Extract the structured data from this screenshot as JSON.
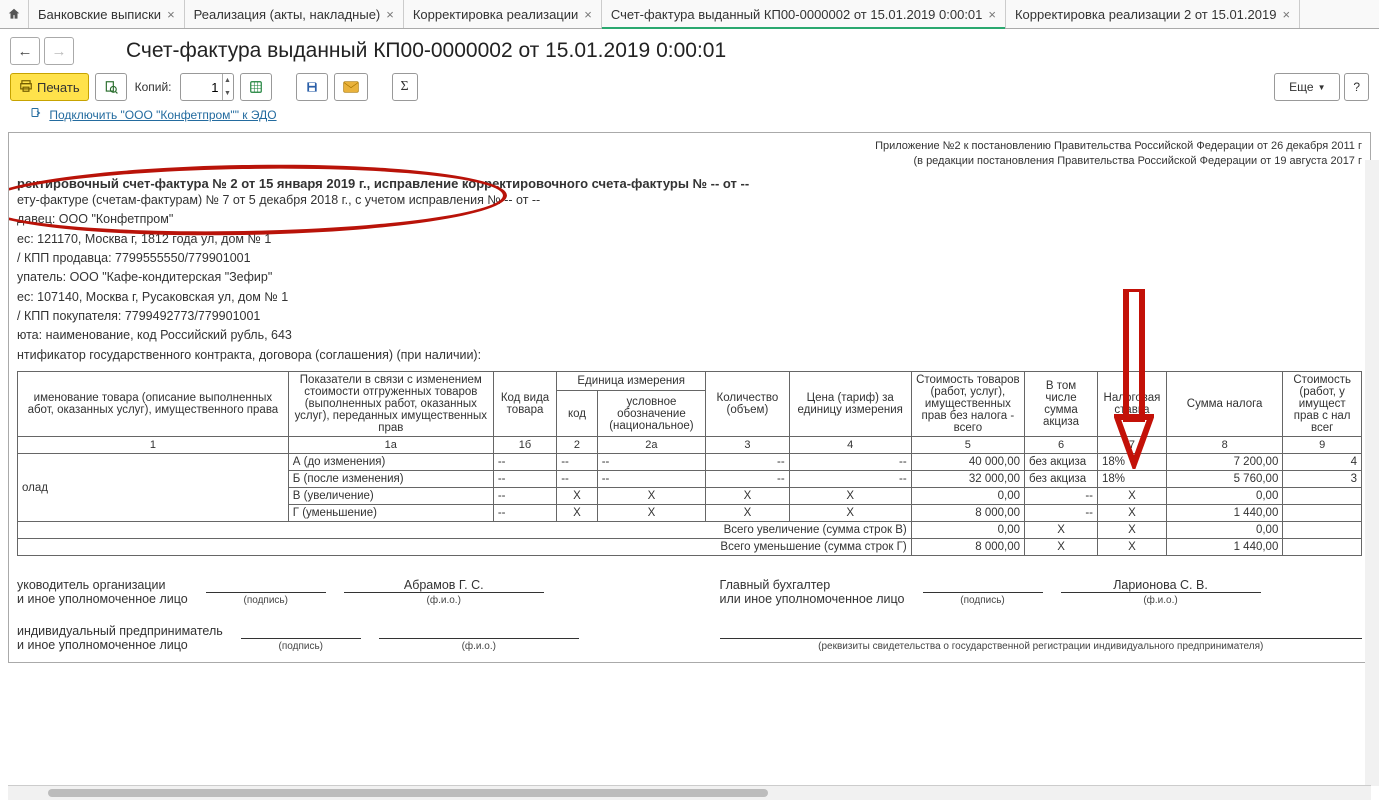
{
  "tabs": [
    {
      "label": "Банковские выписки"
    },
    {
      "label": "Реализация (акты, накладные)"
    },
    {
      "label": "Корректировка реализации"
    },
    {
      "label": "Счет-фактура выданный КП00-0000002 от 15.01.2019 0:00:01",
      "active": true
    },
    {
      "label": "Корректировка реализации 2 от 15.01.2019"
    }
  ],
  "title": "Счет-фактура выданный КП00-0000002 от 15.01.2019 0:00:01",
  "toolbar": {
    "print": "Печать",
    "copies_label": "Копий:",
    "copies_value": "1",
    "more": "Еще",
    "help": "?"
  },
  "link": "Подключить \"ООО \"Конфетпром\"\" к ЭДО",
  "appendix": {
    "l1": "Приложение №2 к постановлению Правительства Российской Федерации от 26 декабря 2011 г",
    "l2": "(в редакции постановления Правительства Российской Федерации от 19 августа 2017 г"
  },
  "doc": {
    "header": "ректировочный счет-фактура № 2 от 15 января 2019 г., исправление корректировочного счета-фактуры № -- от --",
    "l1": "ету-фактуре (счетам-фактурам) № 7 от 5 декабря 2018 г., с учетом исправления № -- от --",
    "l2": "давец: ООО \"Конфетпром\"",
    "l3": "ес: 121170, Москва г, 1812 года ул, дом № 1",
    "l4": " / КПП продавца: 7799555550/779901001",
    "l5": "упатель: ООО \"Кафе-кондитерская \"Зефир\"",
    "l6": "ес: 107140, Москва г, Русаковская ул, дом № 1",
    "l7": " / КПП покупателя: 7799492773/779901001",
    "l8": "юта: наименование, код Российский рубль, 643",
    "l9": "нтификатор государственного контракта, договора (соглашения) (при наличии):"
  },
  "table": {
    "h": {
      "c1": "именование товара (описание выполненных абот, оказанных услуг), имущественного права",
      "c1a": "Показатели в связи с изменением стоимости отгруженных товаров (выполненных работ, оказанных услуг), переданных имущественных прав",
      "c1b": "Код вида товара",
      "c2g": "Единица измерения",
      "c2": "код",
      "c2a": "условное обозначение (национальное)",
      "c3": "Количество (объем)",
      "c4": "Цена (тариф) за единицу измерения",
      "c5": "Стоимость товаров (работ, услуг), имущественных прав без налога - всего",
      "c6": "В том числе сумма акциза",
      "c7": "Налоговая ставка",
      "c8": "Сумма налога",
      "c9": "Стоимость (работ, у имущест прав с нал всег"
    },
    "cn": [
      "1",
      "1а",
      "1б",
      "2",
      "2а",
      "3",
      "4",
      "5",
      "6",
      "7",
      "8",
      "9"
    ],
    "name": "олад",
    "rows": [
      {
        "lab": "А (до изменения)",
        "b": "--",
        "c": "--",
        "ca": "--",
        "q": "--",
        "p": "--",
        "v5": "40 000,00",
        "v6": "без акциза",
        "v7": "18%",
        "v8": "7 200,00",
        "v9": "4"
      },
      {
        "lab": "Б (после изменения)",
        "b": "--",
        "c": "--",
        "ca": "--",
        "q": "--",
        "p": "--",
        "v5": "32 000,00",
        "v6": "без акциза",
        "v7": "18%",
        "v8": "5 760,00",
        "v9": "3"
      },
      {
        "lab": "В (увеличение)",
        "b": "--",
        "c": "Х",
        "ca": "Х",
        "q": "Х",
        "p": "Х",
        "v5": "0,00",
        "v6": "--",
        "v7": "Х",
        "v8": "0,00",
        "v9": ""
      },
      {
        "lab": "Г (уменьшение)",
        "b": "--",
        "c": "Х",
        "ca": "Х",
        "q": "Х",
        "p": "Х",
        "v5": "8 000,00",
        "v6": "--",
        "v7": "Х",
        "v8": "1 440,00",
        "v9": ""
      }
    ],
    "totals": [
      {
        "lab": "Всего увеличение (сумма строк В)",
        "v5": "0,00",
        "v6": "Х",
        "v7": "Х",
        "v8": "0,00",
        "v9": ""
      },
      {
        "lab": "Всего уменьшение (сумма строк Г)",
        "v5": "8 000,00",
        "v6": "Х",
        "v7": "Х",
        "v8": "1 440,00",
        "v9": ""
      }
    ]
  },
  "sign": {
    "head_label": "уководитель организации\nи иное уполномоченное лицо",
    "acc_label": "Главный бухгалтер\nили иное уполномоченное лицо",
    "ip_label": "индивидуальный предприниматель\nи иное уполномоченное лицо",
    "head_name": "Абрамов Г. С.",
    "acc_name": "Ларионова С. В.",
    "caps": {
      "sign": "(подпись)",
      "fio": "(ф.и.о.)",
      "req": "(реквизиты свидетельства о государственной регистрации индивидуального предпринимателя)"
    }
  }
}
